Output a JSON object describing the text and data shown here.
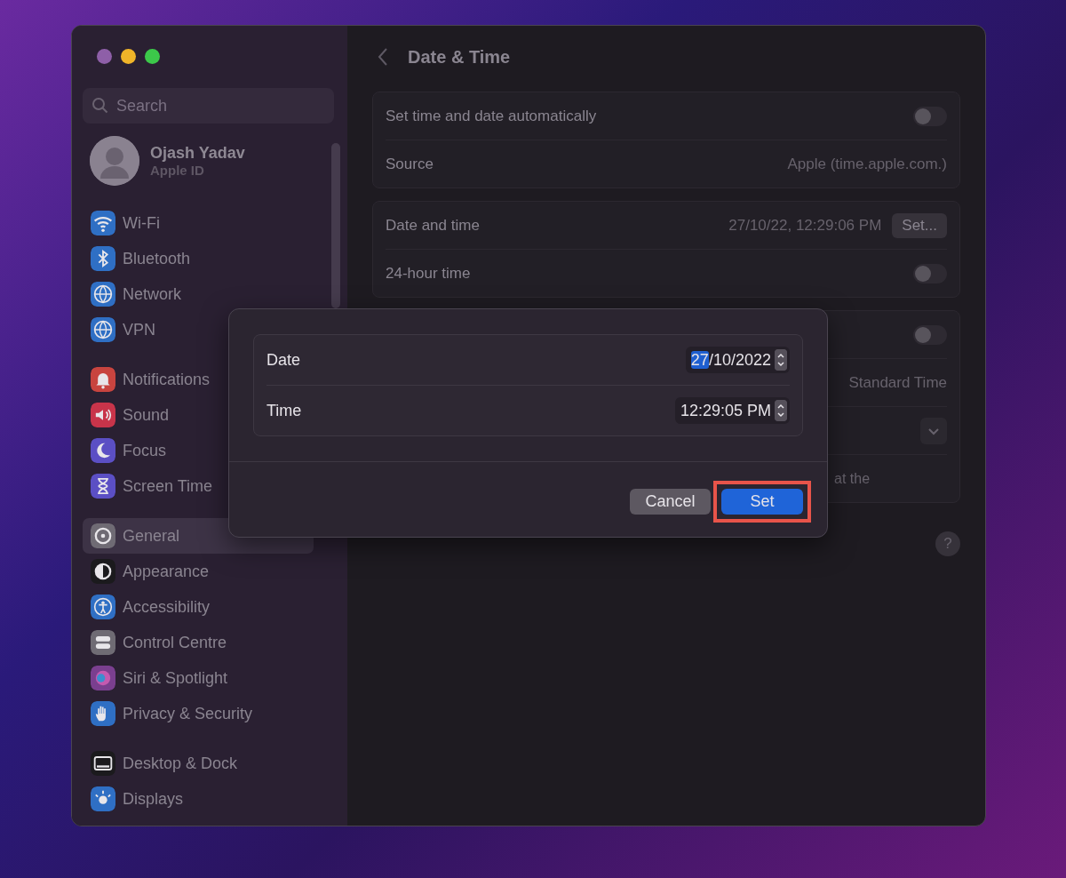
{
  "sidebar": {
    "search": {
      "placeholder": "Search"
    },
    "profile": {
      "name": "Ojash Yadav",
      "subtitle": "Apple ID"
    },
    "groups": [
      {
        "items": [
          {
            "label": "Wi-Fi",
            "kind": "wifi",
            "color": "#2f6fc4",
            "selected": false
          },
          {
            "label": "Bluetooth",
            "kind": "bluetooth",
            "color": "#2f6fc4",
            "selected": false
          },
          {
            "label": "Network",
            "kind": "globe",
            "color": "#2f6fc4",
            "selected": false
          },
          {
            "label": "VPN",
            "kind": "globe",
            "color": "#2f6fc4",
            "selected": false
          }
        ]
      },
      {
        "items": [
          {
            "label": "Notifications",
            "kind": "bell",
            "color": "#c8443f",
            "selected": false
          },
          {
            "label": "Sound",
            "kind": "speaker",
            "color": "#c8344a",
            "selected": false
          },
          {
            "label": "Focus",
            "kind": "moon",
            "color": "#5b4fc4",
            "selected": false
          },
          {
            "label": "Screen Time",
            "kind": "hourglass",
            "color": "#5b4fc4",
            "selected": false
          }
        ]
      },
      {
        "items": [
          {
            "label": "General",
            "kind": "gear",
            "color": "#6f6b74",
            "selected": true
          },
          {
            "label": "Appearance",
            "kind": "contrast",
            "color": "#1b1a1d",
            "selected": false
          },
          {
            "label": "Accessibility",
            "kind": "person",
            "color": "#2f6fc4",
            "selected": false
          },
          {
            "label": "Control Centre",
            "kind": "switches",
            "color": "#6f6b74",
            "selected": false
          },
          {
            "label": "Siri & Spotlight",
            "kind": "orb",
            "color": "#7a3f8f",
            "selected": false
          },
          {
            "label": "Privacy & Security",
            "kind": "hand",
            "color": "#2f6fc4",
            "selected": false
          }
        ]
      },
      {
        "items": [
          {
            "label": "Desktop & Dock",
            "kind": "dock",
            "color": "#1b1a1d",
            "selected": false
          },
          {
            "label": "Displays",
            "kind": "sun",
            "color": "#2f6fc4",
            "selected": false
          }
        ]
      }
    ]
  },
  "content": {
    "title": "Date & Time",
    "groups": [
      {
        "rows": [
          {
            "kind": "toggle",
            "label": "Set time and date automatically",
            "on": false
          },
          {
            "kind": "value",
            "label": "Source",
            "value": "Apple (time.apple.com.)"
          }
        ]
      },
      {
        "rows": [
          {
            "kind": "button",
            "label": "Date and time",
            "value": "27/10/22, 12:29:06 PM",
            "button": "Set..."
          },
          {
            "kind": "toggle",
            "label": "24-hour time",
            "on": false
          }
        ]
      },
      {
        "rows": [
          {
            "kind": "toggle",
            "on": false
          },
          {
            "kind": "value",
            "value": "Standard Time"
          },
          {
            "kind": "dropdown"
          },
          {
            "kind": "note",
            "text": "at the"
          }
        ]
      }
    ],
    "help": "?"
  },
  "dialog": {
    "rows": [
      {
        "label": "Date",
        "separator": "/",
        "segments": [
          {
            "text": "27",
            "selected": true
          },
          {
            "text": "10",
            "selected": false
          },
          {
            "text": "2022",
            "selected": false
          }
        ]
      },
      {
        "label": "Time",
        "separator": ":",
        "segments": [
          {
            "text": "12",
            "selected": false
          },
          {
            "text": "29",
            "selected": false
          },
          {
            "text": "05 PM",
            "selected": false
          }
        ]
      }
    ],
    "buttons": [
      {
        "label": "Cancel",
        "kind": "secondary",
        "highlighted": false
      },
      {
        "label": "Set",
        "kind": "primary",
        "highlighted": true
      }
    ]
  }
}
